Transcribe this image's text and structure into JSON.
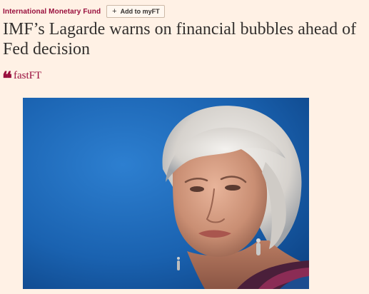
{
  "article": {
    "topic": "International Monetary Fund",
    "myft_button": {
      "icon": "plus-icon",
      "icon_glyph": "+",
      "label": "Add to myFT"
    },
    "headline": "IMF’s Lagarde warns on financial bubbles ahead of Fed decision",
    "brand": {
      "icon": "quote-mark-icon",
      "icon_glyph": "❝",
      "label": "fastFT"
    },
    "image": {
      "subject": "Portrait photograph of Christine Lagarde against a blue background"
    }
  },
  "colors": {
    "page_background": "#fff1e5",
    "topic_link": "#990f3d",
    "headline_text": "#33302e",
    "brand_accent": "#990f3d",
    "photo_background": "#1a62b0"
  }
}
